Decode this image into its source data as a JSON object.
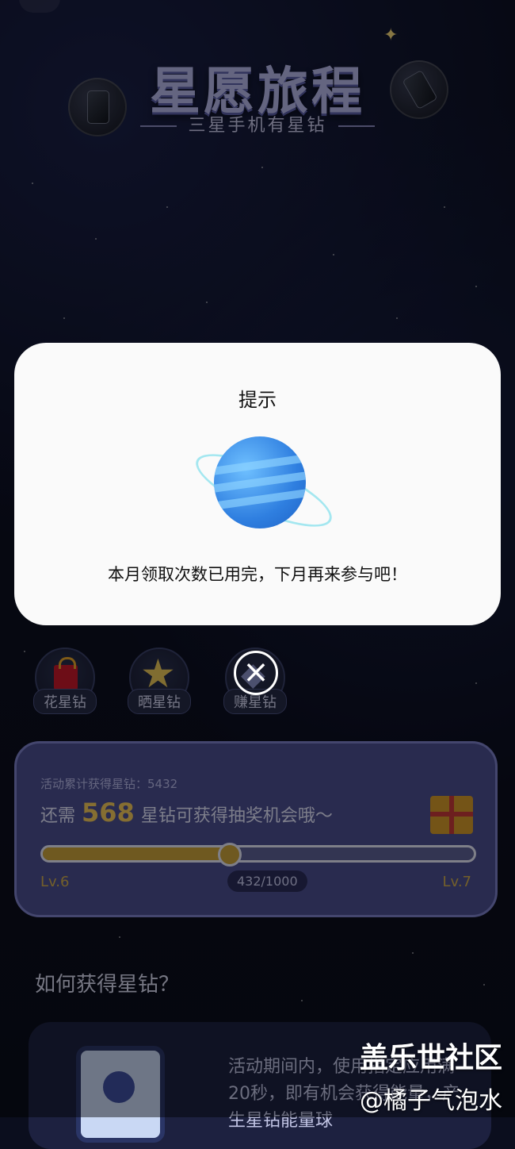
{
  "header": {
    "title": "星愿旅程",
    "subtitle": "三星手机有星钻"
  },
  "categories": [
    {
      "label": "花星钻",
      "icon": "shopping-bag-icon"
    },
    {
      "label": "晒星钻",
      "icon": "star-icon"
    },
    {
      "label": "赚星钻",
      "icon": "diamond-icon"
    }
  ],
  "progress": {
    "total_label": "活动累计获得星钻：5432",
    "need_prefix": "还需",
    "need_value": "568",
    "need_suffix": "星钻可获得抽奖机会哦～",
    "current_level": "Lv.6",
    "next_level": "Lv.7",
    "progress_text": "432/1000",
    "progress_fraction": 0.432
  },
  "how": {
    "title": "如何获得星钻？",
    "description": "活动期间内，使用指定应用满20秒，即有机会获得能量，产生星钻能量球"
  },
  "dialog": {
    "title": "提示",
    "message": "本月领取次数已用完，下月再来参与吧！",
    "close_icon": "close-icon"
  },
  "watermark": {
    "line1": "盖乐世社区",
    "line2": "@橘子气泡水"
  },
  "colors": {
    "accent_gold": "#caa23b",
    "card_purple": "#4b4f90",
    "dialog_bg": "#fafafa"
  }
}
